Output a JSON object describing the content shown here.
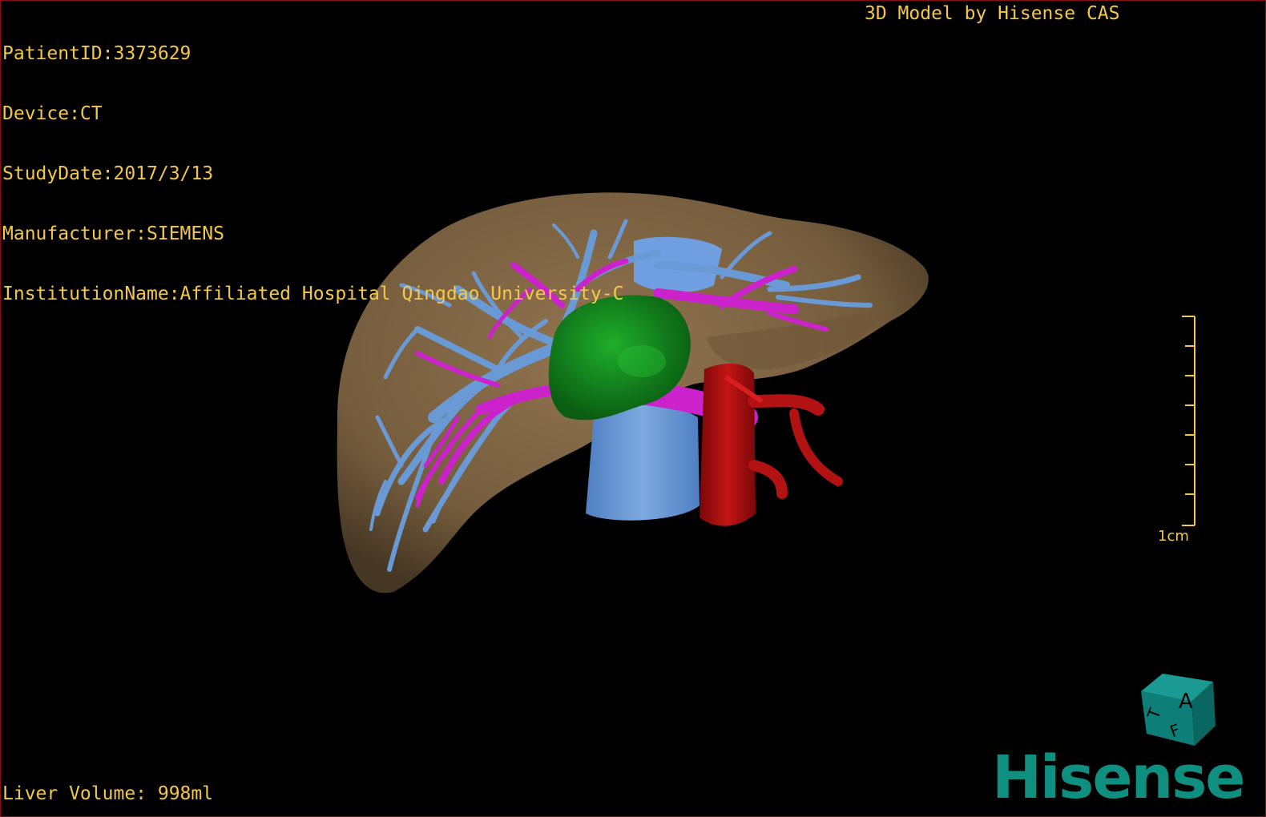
{
  "header": {
    "patient_id": "PatientID:3373629",
    "device": "Device:CT",
    "study_date": "StudyDate:2017/3/13",
    "manufacturer": "Manufacturer:SIEMENS",
    "institution": "InstitutionName:Affiliated Hospital Qingdao University-C",
    "app_title": "3D Model by Hisense CAS"
  },
  "footer": {
    "liver_volume": "Liver Volume: 998ml"
  },
  "scale_bar": {
    "label": "1cm"
  },
  "orientation_cube": {
    "face_labels": [
      "A",
      "F",
      "T"
    ],
    "color": "#0e7e78"
  },
  "brand": {
    "logo_text": "Hisense",
    "color": "#0e8f80"
  },
  "colors": {
    "overlay_text": "#f4c84a",
    "liver": "#8a6e4a",
    "hepatic_vein": "#6a9ad6",
    "portal_vein": "#cc22cc",
    "tumor": "#138a1e",
    "artery": "#a81010",
    "border": "#8a1010"
  },
  "structures": [
    "liver-surface",
    "hepatic-vein-tree",
    "portal-vein-tree",
    "tumor",
    "inferior-vena-cava",
    "hepatic-artery"
  ]
}
